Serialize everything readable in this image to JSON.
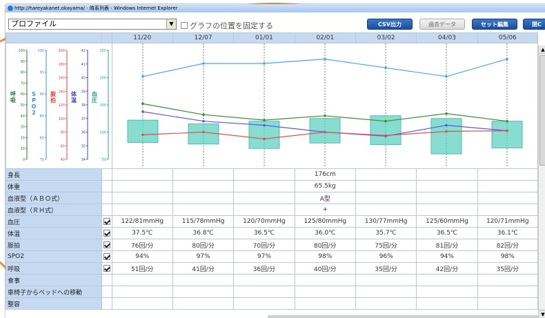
{
  "window": {
    "title": "http://hareyakanet.okayama/ - 時系列表 - Windows Internet Explorer"
  },
  "toolbar": {
    "profile_select": "プロファイル",
    "fix_graph_label": "グラフの位置を固定する",
    "csv_button": "CSV出力",
    "past_button": "過去データ",
    "set_button": "セット編集",
    "close_button": "閉C"
  },
  "grid": {
    "dates": [
      "11/20",
      "12/07",
      "01/01",
      "02/01",
      "03/02",
      "04/03",
      "05/06"
    ],
    "rows": [
      {
        "label": "身長",
        "check": false,
        "values": [
          "",
          "",
          "",
          "176cm",
          "",
          "",
          ""
        ]
      },
      {
        "label": "体重",
        "check": false,
        "values": [
          "",
          "",
          "",
          "65.5kg",
          "",
          "",
          ""
        ]
      },
      {
        "label": "血液型（ＡＢＯ式）",
        "check": false,
        "values": [
          "",
          "",
          "",
          "A型",
          "",
          "",
          ""
        ]
      },
      {
        "label": "血液型（ＲＨ式）",
        "check": false,
        "values": [
          "",
          "",
          "",
          "+",
          "",
          "",
          ""
        ]
      },
      {
        "label": "血圧",
        "check": true,
        "values": [
          "122/81mmHg",
          "115/78mmHg",
          "120/70mmHg",
          "125/80mmHg",
          "130/77mmHg",
          "125/60mmHg",
          "120/71mmHg"
        ]
      },
      {
        "label": "体温",
        "check": true,
        "values": [
          "37.5℃",
          "36.8℃",
          "36.5℃",
          "36.0℃",
          "35.7℃",
          "36.5℃",
          "36.1℃"
        ]
      },
      {
        "label": "脈拍",
        "check": true,
        "values": [
          "76回/分",
          "80回/分",
          "70回/分",
          "80回/分",
          "75回/分",
          "81回/分",
          "82回/分"
        ]
      },
      {
        "label": "SPO2",
        "check": true,
        "values": [
          "94%",
          "97%",
          "97%",
          "98%",
          "96%",
          "94%",
          "98%"
        ]
      },
      {
        "label": "呼吸",
        "check": true,
        "values": [
          "51回/分",
          "41回/分",
          "36回/分",
          "40回/分",
          "35回/分",
          "42回/分",
          "35回/分"
        ]
      },
      {
        "label": "食事",
        "check": false,
        "values": [
          "",
          "",
          "",
          "",
          "",
          "",
          ""
        ]
      },
      {
        "label": "車椅子からベッドへの移動",
        "check": false,
        "values": [
          "",
          "",
          "",
          "",
          "",
          "",
          ""
        ]
      },
      {
        "label": "整容",
        "check": false,
        "values": [
          "",
          "",
          "",
          "",
          "",
          "",
          ""
        ]
      }
    ]
  },
  "chart_axes": {
    "resp": {
      "label": "呼吸",
      "ticks": [
        "100",
        "90",
        "80",
        "70",
        "60",
        "50",
        "40",
        "30",
        "20",
        "10",
        "0"
      ]
    },
    "spo2": {
      "label": "SPO2",
      "ticks": [
        "100",
        "95",
        "90",
        "85",
        "80",
        "75"
      ]
    },
    "pulse": {
      "label": "脈拍",
      "ticks": [
        "200",
        "180",
        "160",
        "140",
        "120",
        "100",
        "80",
        "60",
        "40"
      ]
    },
    "temp": {
      "label": "体温",
      "ticks": [
        "42",
        "41",
        "40",
        "39",
        "38",
        "37",
        "36",
        "35",
        "34"
      ]
    },
    "bp": {
      "label": "血圧",
      "ticks": [
        "250",
        "200",
        "150",
        "100",
        "50"
      ]
    }
  },
  "chart_data": {
    "type": "line",
    "categories": [
      "11/20",
      "12/07",
      "01/01",
      "02/01",
      "03/02",
      "04/03",
      "05/06"
    ],
    "series": [
      {
        "name": "SPO2",
        "color": "#4aa3f0",
        "values": [
          94,
          97,
          97,
          98,
          96,
          94,
          98
        ]
      },
      {
        "name": "呼吸",
        "color": "#3a8a3a",
        "values": [
          51,
          41,
          36,
          40,
          35,
          42,
          35
        ]
      },
      {
        "name": "体温",
        "color": "#5a5ae8",
        "values": [
          37.5,
          36.8,
          36.5,
          36.0,
          35.7,
          36.5,
          36.1
        ]
      },
      {
        "name": "脈拍",
        "color": "#e05050",
        "values": [
          76,
          80,
          70,
          80,
          75,
          81,
          82
        ]
      },
      {
        "name": "血圧",
        "color": "#5fd1c0",
        "high": [
          122,
          115,
          120,
          125,
          130,
          125,
          120
        ],
        "low": [
          81,
          78,
          70,
          80,
          77,
          60,
          71
        ]
      }
    ]
  },
  "colors": {
    "header_bg": "#c5daf0",
    "button_blue": "#1a4f9c"
  }
}
